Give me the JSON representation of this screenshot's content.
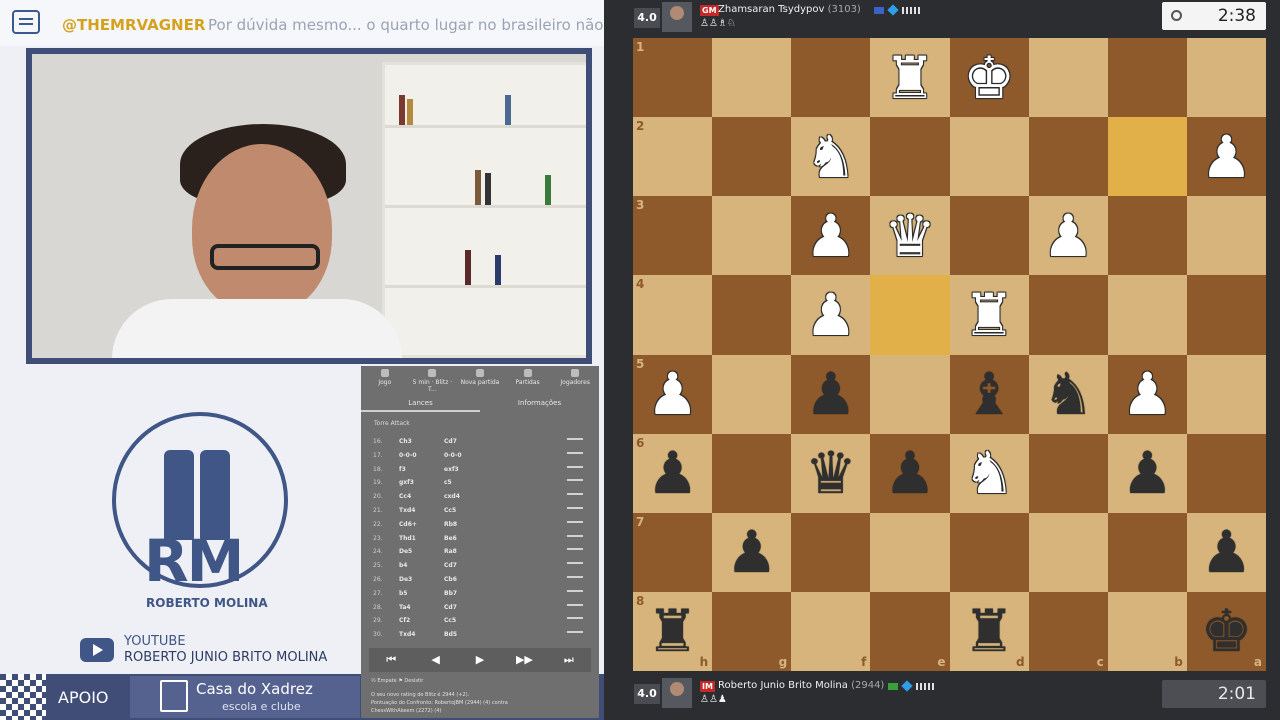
{
  "stream": {
    "handle": "@THEMRVAGNER",
    "ticker_text": "Por dúvida mesmo... o quarto lugar no brasileiro não d",
    "logo_name": "ROBERTO MOLINA",
    "youtube_label": "YOUTUBE",
    "youtube_channel": "ROBERTO JUNIO BRITO MOLINA",
    "apoio_label": "APOIO",
    "sponsor_line1": "Casa do Xadrez",
    "sponsor_line2": "escola e clube"
  },
  "panel": {
    "tabs": [
      "Jogo",
      "5 min · Blitz · T...",
      "Nova partida",
      "Partidas",
      "Jogadores"
    ],
    "subtabs": [
      "Lances",
      "Informações"
    ],
    "opening": "Torre Attack",
    "moves": [
      {
        "n": "16.",
        "w": "Ch3",
        "b": "Cd7"
      },
      {
        "n": "17.",
        "w": "0-0-0",
        "b": "0-0-0"
      },
      {
        "n": "18.",
        "w": "f3",
        "b": "exf3"
      },
      {
        "n": "19.",
        "w": "gxf3",
        "b": "c5"
      },
      {
        "n": "20.",
        "w": "Cc4",
        "b": "cxd4"
      },
      {
        "n": "21.",
        "w": "Txd4",
        "b": "Cc5"
      },
      {
        "n": "22.",
        "w": "Cd6+",
        "b": "Rb8"
      },
      {
        "n": "23.",
        "w": "Thd1",
        "b": "Be6"
      },
      {
        "n": "24.",
        "w": "De5",
        "b": "Ra8"
      },
      {
        "n": "25.",
        "w": "b4",
        "b": "Cd7"
      },
      {
        "n": "26.",
        "w": "De3",
        "b": "Cb6"
      },
      {
        "n": "27.",
        "w": "b5",
        "b": "Bb7"
      },
      {
        "n": "28.",
        "w": "Ta4",
        "b": "Cd7"
      },
      {
        "n": "29.",
        "w": "Cf2",
        "b": "Cc5"
      },
      {
        "n": "30.",
        "w": "Txd4",
        "b": "Bd5"
      }
    ],
    "nav": [
      "⏮",
      "◀",
      "▶",
      "▶▶",
      "⏭"
    ],
    "actions": "½ Empate   ⚑ Desistir",
    "status1": "O seu novo rating de Blitz é 2944 (+2).",
    "status2": "Pontuação do Confronto: RobertoJBM (2944) (4) contra",
    "status3": "ChessWithAkeem (2272) (4)"
  },
  "top_player": {
    "rating_badge": "4.0",
    "title": "GM",
    "name": "Zhamsaran Tsydypov",
    "rating": "(3103)",
    "captured": "♙♙♗♘",
    "clock": "2:38"
  },
  "bottom_player": {
    "rating_badge": "4.0",
    "title": "IM",
    "name": "Roberto Junio Brito Molina",
    "rating": "(2944)",
    "captured": "♙♙♟",
    "clock": "2:01"
  },
  "board": {
    "highlight_squares": [
      "e4",
      "b2"
    ],
    "ranks": [
      "1",
      "2",
      "3",
      "4",
      "5",
      "6",
      "7",
      "8"
    ],
    "files": [
      "h",
      "g",
      "f",
      "e",
      "d",
      "c",
      "b",
      "a"
    ],
    "pieces": [
      {
        "sq": "e1",
        "p": "R",
        "c": "w"
      },
      {
        "sq": "d1",
        "p": "K",
        "c": "w"
      },
      {
        "sq": "f2",
        "p": "N",
        "c": "w"
      },
      {
        "sq": "a2",
        "p": "P",
        "c": "w"
      },
      {
        "sq": "f3",
        "p": "P",
        "c": "w"
      },
      {
        "sq": "e3",
        "p": "Q",
        "c": "w"
      },
      {
        "sq": "c3",
        "p": "P",
        "c": "w"
      },
      {
        "sq": "f4",
        "p": "P",
        "c": "w"
      },
      {
        "sq": "d4",
        "p": "R",
        "c": "w"
      },
      {
        "sq": "h5",
        "p": "P",
        "c": "w"
      },
      {
        "sq": "f5",
        "p": "P",
        "c": "b"
      },
      {
        "sq": "d5",
        "p": "B",
        "c": "b"
      },
      {
        "sq": "c5",
        "p": "N",
        "c": "b"
      },
      {
        "sq": "b5",
        "p": "P",
        "c": "w"
      },
      {
        "sq": "h6",
        "p": "P",
        "c": "b"
      },
      {
        "sq": "f6",
        "p": "Q",
        "c": "b"
      },
      {
        "sq": "e6",
        "p": "P",
        "c": "b"
      },
      {
        "sq": "d6",
        "p": "N",
        "c": "w"
      },
      {
        "sq": "b6",
        "p": "P",
        "c": "b"
      },
      {
        "sq": "g7",
        "p": "P",
        "c": "b"
      },
      {
        "sq": "a7",
        "p": "P",
        "c": "b"
      },
      {
        "sq": "h8",
        "p": "R",
        "c": "b"
      },
      {
        "sq": "d8",
        "p": "R",
        "c": "b"
      },
      {
        "sq": "a8",
        "p": "K",
        "c": "b"
      }
    ]
  },
  "colors": {
    "light_square": "#d6b47c",
    "dark_square": "#8f5a2b",
    "highlight": "#e2b048",
    "brand": "#3f4d77"
  }
}
